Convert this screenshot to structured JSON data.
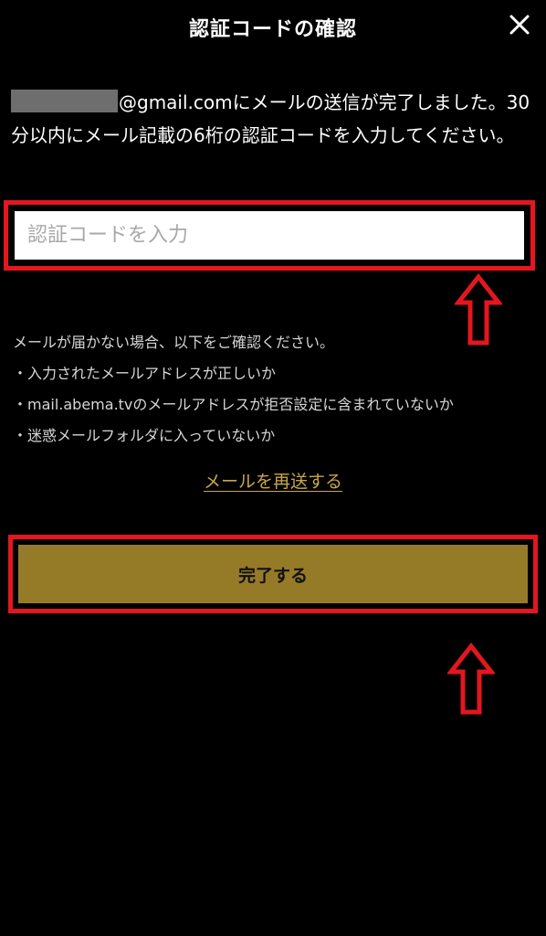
{
  "header": {
    "title": "認証コードの確認",
    "close_icon": "close-icon"
  },
  "message": {
    "email_suffix": "@gmail.com",
    "text": "にメールの送信が完了しました。30分以内にメール記載の6桁の認証コードを入力してください。"
  },
  "code_input": {
    "placeholder": "認証コードを入力",
    "value": ""
  },
  "help": {
    "heading": "メールが届かない場合、以下をご確認ください。",
    "items": [
      "・入力されたメールアドレスが正しいか",
      "・mail.abema.tvのメールアドレスが拒否設定に含まれていないか",
      "・迷惑メールフォルダに入っていないか"
    ]
  },
  "resend_label": "メールを再送する",
  "complete_label": "完了する",
  "colors": {
    "background": "#000000",
    "accent_gold": "#957b28",
    "link_gold": "#c9a64a",
    "highlight_red": "#e4161f"
  },
  "annotations": {
    "arrow_icon": "up-arrow-icon"
  }
}
